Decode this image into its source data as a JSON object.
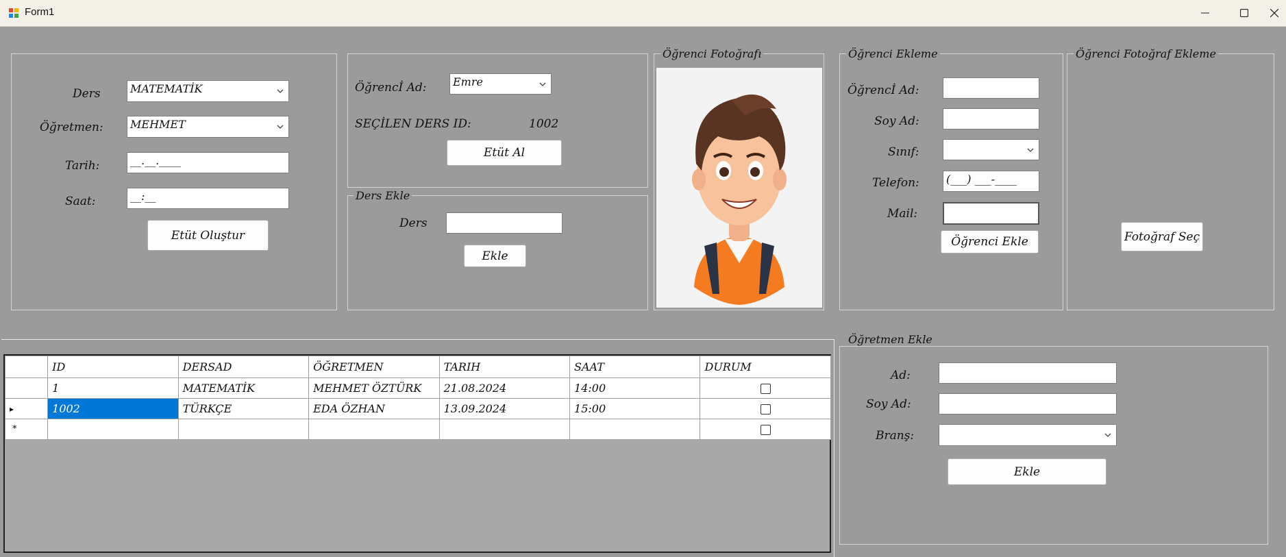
{
  "window": {
    "title": "Form1",
    "icon": "app-window-icon"
  },
  "etut": {
    "ders_label": "Ders",
    "ders_value": "MATEMATİK",
    "ogretmen_label": "Öğretmen:",
    "ogretmen_value": "MEHMET",
    "tarih_label": "Tarih:",
    "tarih_mask": "__.__.____",
    "saat_label": "Saat:",
    "saat_mask": "__:__",
    "button": "Etüt Oluştur"
  },
  "etut_al": {
    "ogrenci_label": "Öğrencİ Ad:",
    "ogrenci_value": "Emre",
    "secilen_label": "SEÇİLEN DERS ID:",
    "secilen_value": "1002",
    "button": "Etüt Al"
  },
  "ders_ekle": {
    "legend": "Ders Ekle",
    "ders_label": "Ders",
    "ders_value": "",
    "button": "Ekle"
  },
  "foto": {
    "legend": "Öğrenci Fotoğrafı",
    "image": "student-cartoon-photo"
  },
  "ogrenci_ekleme": {
    "legend": "Öğrenci Ekleme",
    "ad_label": "Öğrencİ Ad:",
    "soyad_label": "Soy Ad:",
    "sinif_label": "Sınıf:",
    "telefon_label": "Telefon:",
    "telefon_mask": "(___) ___-____",
    "mail_label": "Mail:",
    "button": "Öğrenci Ekle"
  },
  "foto_ekleme": {
    "legend": "Öğrenci Fotoğraf Ekleme",
    "button": "Fotoğraf Seç"
  },
  "ogretmen_ekle": {
    "legend": "Öğretmen Ekle",
    "ad_label": "Ad:",
    "soyad_label": "Soy Ad:",
    "brans_label": "Branş:",
    "button": "Ekle"
  },
  "grid": {
    "columns": [
      "ID",
      "DERSAD",
      "ÖĞRETMEN",
      "TARIH",
      "SAAT",
      "DURUM"
    ],
    "rows": [
      {
        "id": "1",
        "ders": "MATEMATİK",
        "ogretmen": "MEHMET ÖZTÜRK",
        "tarih": "21.08.2024",
        "saat": "14:00",
        "durum": false
      },
      {
        "id": "1002",
        "ders": "TÜRKÇE",
        "ogretmen": "EDA ÖZHAN",
        "tarih": "13.09.2024",
        "saat": "15:00",
        "durum": false
      }
    ],
    "current_row_marker": "▸",
    "new_row_marker": "*"
  }
}
